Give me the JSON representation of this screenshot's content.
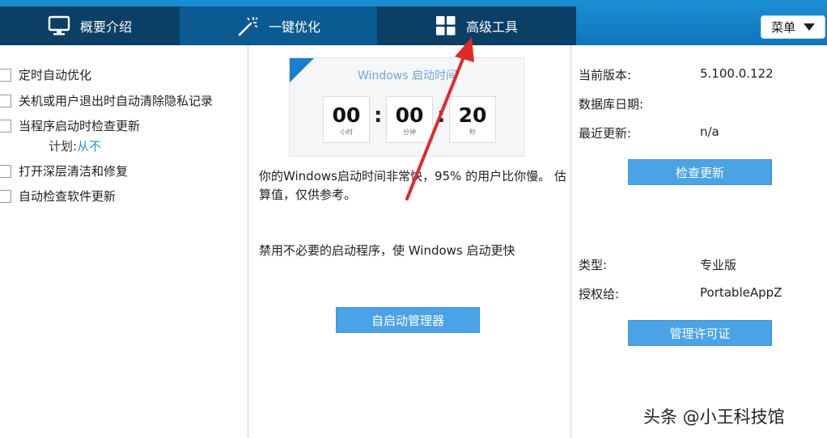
{
  "tabs": [
    {
      "label": "概要介绍",
      "icon": "monitor-icon"
    },
    {
      "label": "一键优化",
      "icon": "magic-wand-icon"
    },
    {
      "label": "高级工具",
      "icon": "grid-icon"
    }
  ],
  "menu": {
    "label": "菜单",
    "icon": "caret-down-icon"
  },
  "left": {
    "options": [
      {
        "label": "定时自动优化"
      },
      {
        "label": "关机或用户退出时自动清除隐私记录"
      },
      {
        "label": "当程序启动时检查更新"
      },
      {
        "label": "打开深层清洁和修复"
      },
      {
        "label": "自动检查软件更新"
      }
    ],
    "plan_label": "计划:",
    "plan_value": "从不"
  },
  "timer": {
    "title": "Windows 启动时间",
    "hours": "00",
    "hours_unit": "小时",
    "minutes": "00",
    "minutes_unit": "分钟",
    "seconds": "20",
    "seconds_unit": "秒",
    "separator": ":"
  },
  "middle": {
    "result_text": "你的Windows启动时间非常快，95% 的用户比你慢。 估算值，仅供参考。",
    "tip_text": "禁用不必要的启动程序，使 Windows 启动更快",
    "startup_button": "自启动管理器"
  },
  "right": {
    "version_label": "当前版本:",
    "version_value": "5.100.0.122",
    "db_date_label": "数据库日期:",
    "db_date_value": "",
    "last_update_label": "最近更新:",
    "last_update_value": "n/a",
    "check_button": "检查更新",
    "type_label": "类型:",
    "type_value": "专业版",
    "licensed_label": "授权给:",
    "licensed_value": "PortableAppZ",
    "license_button": "管理许可证"
  },
  "watermark": "头条 @小王科技馆",
  "colors": {
    "accent": "#1b8fd4",
    "tab_dark": "#0b3f66",
    "button": "#4ba3e6",
    "arrow": "#e02a2a",
    "link": "#2b8de0"
  }
}
